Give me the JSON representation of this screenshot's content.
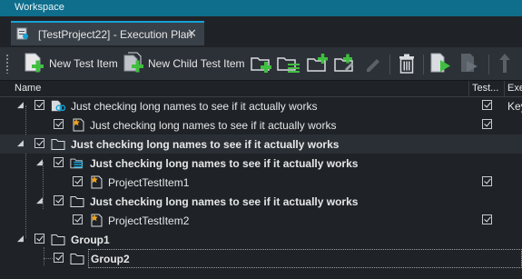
{
  "window": {
    "title": "Workspace"
  },
  "tab": {
    "title": "[TestProject22] - Execution Plan",
    "close": "✕"
  },
  "toolbar": {
    "new_test_item": "New Test Item",
    "new_child_test_item": "New Child Test Item"
  },
  "columns": {
    "name": "Name",
    "test": "Test...",
    "extra": "Exe"
  },
  "rows": [
    {
      "label": "Just checking long names to see if it actually works",
      "col_checked": true,
      "extra": "Key"
    },
    {
      "label": "Just checking long names to see if it actually works",
      "col_checked": true,
      "extra": ""
    },
    {
      "label": "Just checking long names to see if it actually works",
      "col_checked": false,
      "extra": ""
    },
    {
      "label": "Just checking long names to see if it actually works",
      "col_checked": false,
      "extra": ""
    },
    {
      "label": "ProjectTestItem1",
      "col_checked": true,
      "extra": ""
    },
    {
      "label": "Just checking long names to see if it actually works",
      "col_checked": false,
      "extra": ""
    },
    {
      "label": "ProjectTestItem2",
      "col_checked": true,
      "extra": ""
    },
    {
      "label": "Group1",
      "col_checked": false,
      "extra": ""
    },
    {
      "label": "Group2",
      "col_checked": false,
      "extra": ""
    }
  ],
  "colors": {
    "accent": "#14a3d6",
    "add_green": "#3fbf3f",
    "title_bar": "#0f6e8c"
  }
}
